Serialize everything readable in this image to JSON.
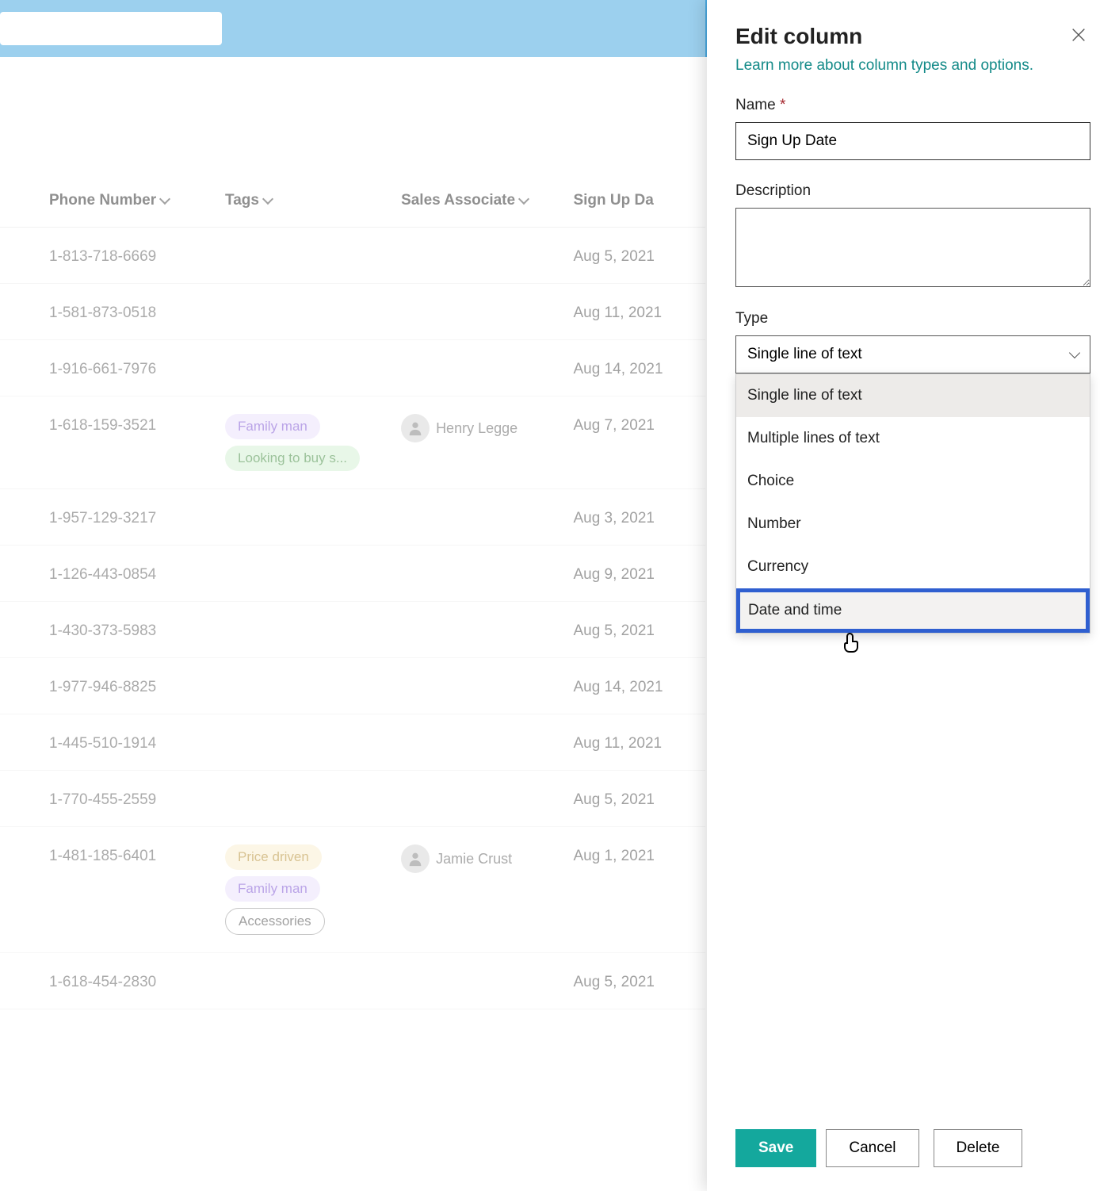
{
  "table": {
    "headers": {
      "phone": "Phone Number",
      "tags": "Tags",
      "sales": "Sales Associate",
      "signup": "Sign Up Da"
    },
    "rows": [
      {
        "phone": "1-813-718-6669",
        "tags": [],
        "sales": "",
        "signup": "Aug 5, 2021"
      },
      {
        "phone": "1-581-873-0518",
        "tags": [],
        "sales": "",
        "signup": "Aug 11, 2021"
      },
      {
        "phone": "1-916-661-7976",
        "tags": [],
        "sales": "",
        "signup": "Aug 14, 2021"
      },
      {
        "phone": "1-618-159-3521",
        "tags": [
          {
            "text": "Family man",
            "style": "purple"
          },
          {
            "text": "Looking to buy s...",
            "style": "green"
          }
        ],
        "sales": "Henry Legge",
        "signup": "Aug 7, 2021"
      },
      {
        "phone": "1-957-129-3217",
        "tags": [],
        "sales": "",
        "signup": "Aug 3, 2021"
      },
      {
        "phone": "1-126-443-0854",
        "tags": [],
        "sales": "",
        "signup": "Aug 9, 2021"
      },
      {
        "phone": "1-430-373-5983",
        "tags": [],
        "sales": "",
        "signup": "Aug 5, 2021"
      },
      {
        "phone": "1-977-946-8825",
        "tags": [],
        "sales": "",
        "signup": "Aug 14, 2021"
      },
      {
        "phone": "1-445-510-1914",
        "tags": [],
        "sales": "",
        "signup": "Aug 11, 2021"
      },
      {
        "phone": "1-770-455-2559",
        "tags": [],
        "sales": "",
        "signup": "Aug 5, 2021"
      },
      {
        "phone": "1-481-185-6401",
        "tags": [
          {
            "text": "Price driven",
            "style": "orange"
          },
          {
            "text": "Family man",
            "style": "purple"
          },
          {
            "text": "Accessories",
            "style": "outline"
          }
        ],
        "sales": "Jamie Crust",
        "signup": "Aug 1, 2021"
      },
      {
        "phone": "1-618-454-2830",
        "tags": [],
        "sales": "",
        "signup": "Aug 5, 2021"
      }
    ]
  },
  "panel": {
    "title": "Edit column",
    "learn_more": "Learn more about column types and options.",
    "name_label": "Name",
    "name_value": "Sign Up Date",
    "description_label": "Description",
    "description_value": "",
    "type_label": "Type",
    "type_selected": "Single line of text",
    "type_options": [
      "Single line of text",
      "Multiple lines of text",
      "Choice",
      "Number",
      "Currency",
      "Date and time"
    ],
    "buttons": {
      "save": "Save",
      "cancel": "Cancel",
      "delete": "Delete"
    }
  }
}
